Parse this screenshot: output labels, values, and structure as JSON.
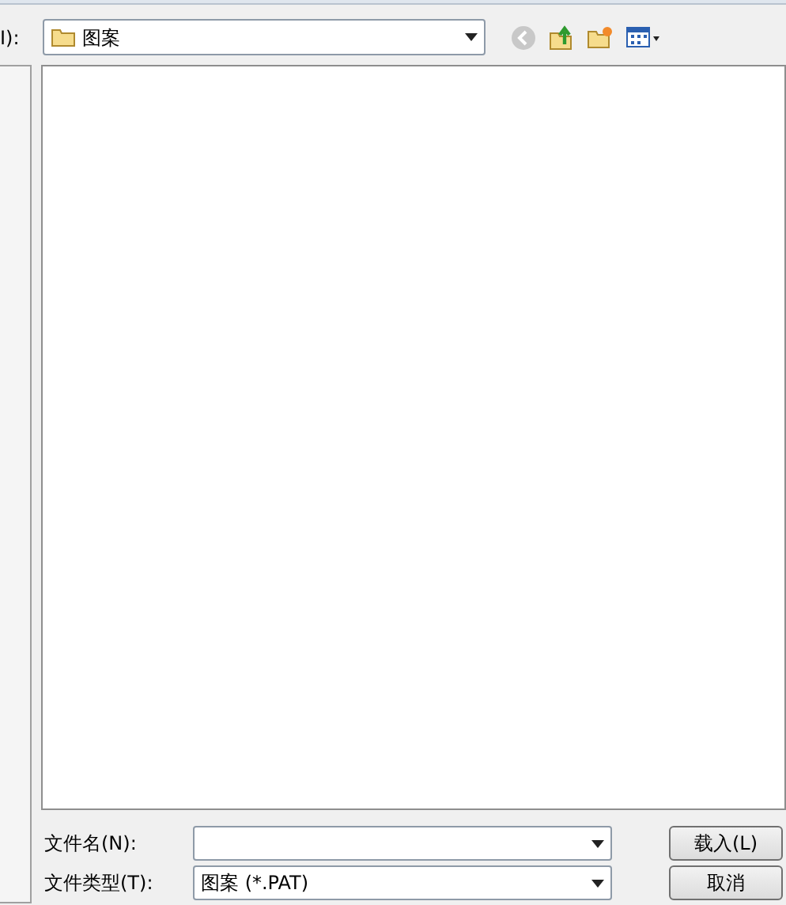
{
  "look_in": {
    "label": "I):",
    "value": "图案"
  },
  "file_name": {
    "label": "文件名(N):"
  },
  "file_type": {
    "label": "文件类型(T):",
    "value": "图案 (*.PAT)"
  },
  "buttons": [
    {
      "label": "载入(L)"
    },
    {
      "label": "取消"
    }
  ]
}
